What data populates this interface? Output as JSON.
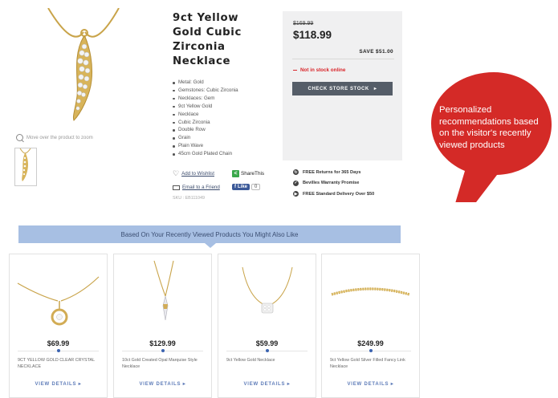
{
  "product": {
    "title": "9ct Yellow Gold Cubic Zirconia Necklace",
    "zoom_hint": "Move over the product to zoom",
    "features": [
      "Metal: Gold",
      "Gemstones: Cubic Zirconia",
      "Necklaces: Gem",
      "9ct Yellow Gold",
      "Necklace",
      "Cubic Zirconia",
      "Double Row",
      "Grain",
      "Plain Wave",
      "45cm Gold Plated Chain"
    ],
    "add_to_wishlist": "Add to Wishlist",
    "email_friend": "Email to a Friend",
    "sharethis": "ShareThis",
    "like_label": "Like",
    "like_count": "0",
    "sku": "SKU : EB111049"
  },
  "pricing": {
    "was": "$169.99",
    "now": "$118.99",
    "save": "SAVE $51.00",
    "stock_status": "Not in stock online",
    "check_store_button": "CHECK STORE STOCK",
    "status_color": "#d9252a"
  },
  "promises": [
    {
      "label": "FREE Returns for 365 Days",
      "icon": "return-icon"
    },
    {
      "label": "Bevilles Warranty Promise",
      "icon": "shield-icon"
    },
    {
      "label": "FREE Standard Delivery Over $50",
      "icon": "truck-icon"
    }
  ],
  "recommendations": {
    "heading": "Based On Your Recently Viewed Products You Might Also Like",
    "view_details_label": "VIEW DETAILS",
    "items": [
      {
        "price": "$69.99",
        "name": "9CT YELLOW GOLD CLEAR CRYSTAL NECKLACE"
      },
      {
        "price": "$129.99",
        "name": "10ct Gold Created Opal Marquise Style Necklace"
      },
      {
        "price": "$59.99",
        "name": "9ct Yellow Gold Necklace"
      },
      {
        "price": "$249.99",
        "name": "9ct Yellow Gold Silver Filled Fancy Link Necklace"
      }
    ]
  },
  "callout": {
    "text": "Personalized recommendations based on the visitor's recently viewed products",
    "color": "#d42a27"
  }
}
